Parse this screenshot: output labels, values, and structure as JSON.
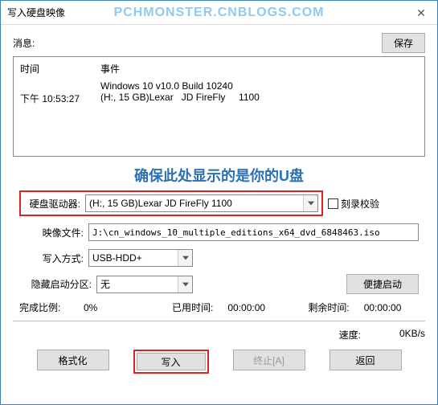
{
  "titlebar": {
    "title": "写入硬盘映像"
  },
  "watermark": "PCHMONSTER.CNBLOGS.COM",
  "close_glyph": "✕",
  "msg_label": "消息:",
  "save_btn": "保存",
  "log": {
    "head_time": "时间",
    "head_event": "事件",
    "rows": [
      {
        "time": "",
        "event": "Windows 10 v10.0 Build 10240"
      },
      {
        "time": "下午 10:53:27",
        "event": "(H:, 15 GB)Lexar   JD FireFly     1100"
      }
    ]
  },
  "annotation": "确保此处显示的是你的U盘",
  "form": {
    "disk_drive_label": "硬盘驱动器:",
    "disk_drive_value": "(H:, 15 GB)Lexar   JD FireFly     1100",
    "verify_label": "刻录校验",
    "image_file_label": "映像文件:",
    "image_file_value": "J:\\cn_windows_10_multiple_editions_x64_dvd_6848463.iso",
    "write_mode_label": "写入方式:",
    "write_mode_value": "USB-HDD+",
    "hidden_boot_label": "隐藏启动分区:",
    "hidden_boot_value": "无",
    "ez_boot_btn": "便捷启动"
  },
  "progress": {
    "done_label": "完成比例:",
    "done_value": "0%",
    "elapsed_label": "已用时间:",
    "elapsed_value": "00:00:00",
    "remain_label": "剩余时间:",
    "remain_value": "00:00:00"
  },
  "speed": {
    "label": "速度:",
    "value": "0KB/s"
  },
  "buttons": {
    "format": "格式化",
    "write": "写入",
    "abort": "终止[A]",
    "back": "返回"
  }
}
